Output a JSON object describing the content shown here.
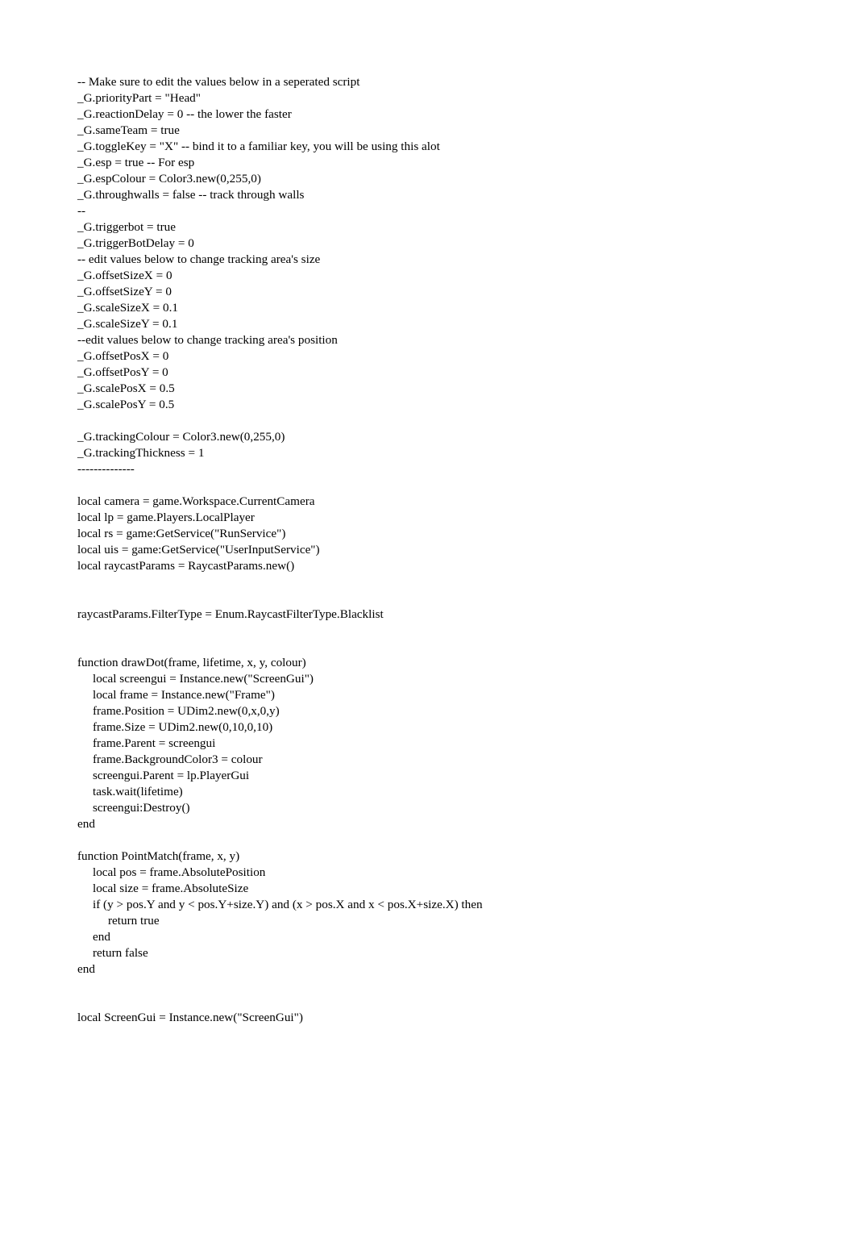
{
  "document": {
    "type": "plain-text-code-listing",
    "language": "Lua",
    "background_color": "#ffffff",
    "text_color": "#000000",
    "lines": [
      "-- Make sure to edit the values below in a seperated script",
      "_G.priorityPart = \"Head\"",
      "_G.reactionDelay = 0 -- the lower the faster",
      "_G.sameTeam = true",
      "_G.toggleKey = \"X\" -- bind it to a familiar key, you will be using this alot",
      "_G.esp = true -- For esp",
      "_G.espColour = Color3.new(0,255,0)",
      "_G.throughwalls = false -- track through walls",
      "--",
      "_G.triggerbot = true",
      "_G.triggerBotDelay = 0",
      "-- edit values below to change tracking area's size",
      "_G.offsetSizeX = 0",
      "_G.offsetSizeY = 0",
      "_G.scaleSizeX = 0.1",
      "_G.scaleSizeY = 0.1",
      "--edit values below to change tracking area's position",
      "_G.offsetPosX = 0",
      "_G.offsetPosY = 0",
      "_G.scalePosX = 0.5",
      "_G.scalePosY = 0.5",
      "",
      "_G.trackingColour = Color3.new(0,255,0)",
      "_G.trackingThickness = 1",
      "--------------",
      "",
      "local camera = game.Workspace.CurrentCamera",
      "local lp = game.Players.LocalPlayer",
      "local rs = game:GetService(\"RunService\")",
      "local uis = game:GetService(\"UserInputService\")",
      "local raycastParams = RaycastParams.new()",
      "",
      "",
      "raycastParams.FilterType = Enum.RaycastFilterType.Blacklist",
      "",
      "",
      "function drawDot(frame, lifetime, x, y, colour)",
      "     local screengui = Instance.new(\"ScreenGui\")",
      "     local frame = Instance.new(\"Frame\")",
      "     frame.Position = UDim2.new(0,x,0,y)",
      "     frame.Size = UDim2.new(0,10,0,10)",
      "     frame.Parent = screengui",
      "     frame.BackgroundColor3 = colour",
      "     screengui.Parent = lp.PlayerGui",
      "     task.wait(lifetime)",
      "     screengui:Destroy()",
      "end",
      "",
      "function PointMatch(frame, x, y)",
      "     local pos = frame.AbsolutePosition",
      "     local size = frame.AbsoluteSize",
      "     if (y > pos.Y and y < pos.Y+size.Y) and (x > pos.X and x < pos.X+size.X) then",
      "          return true",
      "     end",
      "     return false",
      "end",
      "",
      "",
      "local ScreenGui = Instance.new(\"ScreenGui\")"
    ]
  }
}
